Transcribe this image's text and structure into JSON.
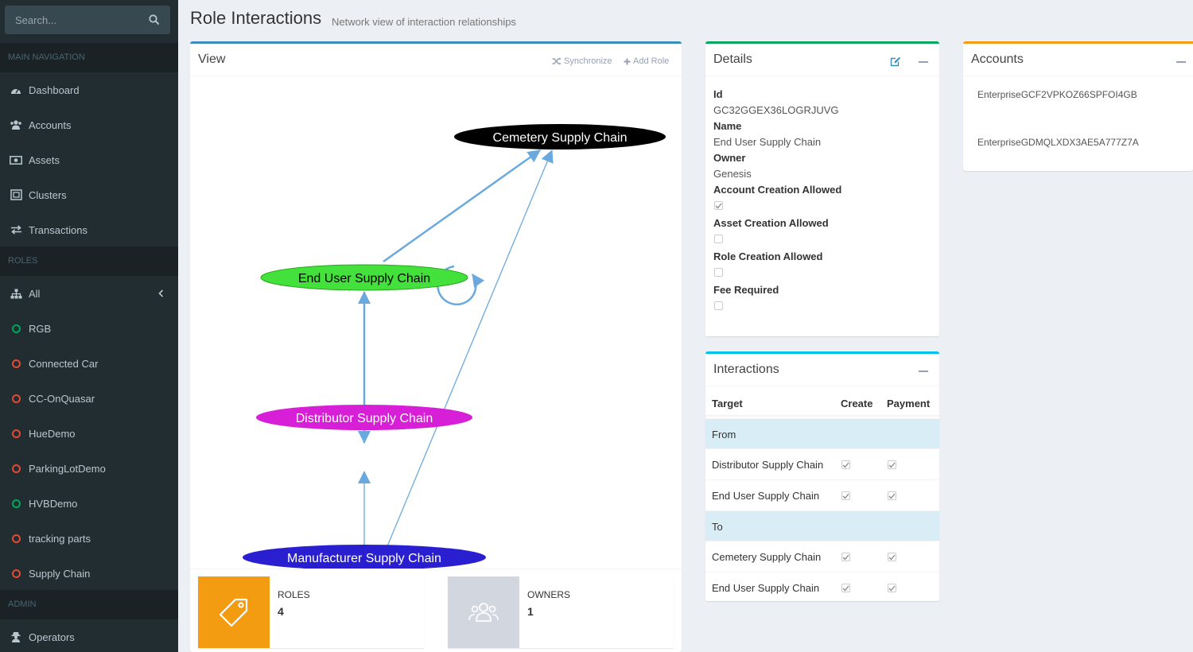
{
  "search": {
    "placeholder": "Search..."
  },
  "nav": {
    "main_header": "MAIN NAVIGATION",
    "main_items": [
      {
        "label": "Dashboard",
        "icon": "dashboard-icon"
      },
      {
        "label": "Accounts",
        "icon": "users-icon"
      },
      {
        "label": "Assets",
        "icon": "money-icon"
      },
      {
        "label": "Clusters",
        "icon": "clusters-icon"
      },
      {
        "label": "Transactions",
        "icon": "exchange-icon"
      }
    ],
    "roles_header": "ROLES",
    "role_items": [
      {
        "label": "All",
        "icon": "sitemap-icon"
      },
      {
        "label": "RGB",
        "status": "green"
      },
      {
        "label": "Connected Car",
        "status": "red"
      },
      {
        "label": "CC-OnQuasar",
        "status": "red"
      },
      {
        "label": "HueDemo",
        "status": "red"
      },
      {
        "label": "ParkingLotDemo",
        "status": "red"
      },
      {
        "label": "HVBDemo",
        "status": "green"
      },
      {
        "label": "tracking parts",
        "status": "red"
      },
      {
        "label": "Supply Chain",
        "status": "red"
      }
    ],
    "admin_header": "ADMIN",
    "admin_items": [
      {
        "label": "Operators",
        "icon": "user-secret-icon"
      }
    ]
  },
  "header": {
    "title": "Role Interactions",
    "subtitle": "Network view of interaction relationships"
  },
  "view": {
    "title": "View",
    "synchronize": "Synchronize",
    "add_role": "Add Role",
    "graph": {
      "nodes": [
        {
          "label": "Cemetery Supply Chain",
          "color": "#000000",
          "text": "#ffffff"
        },
        {
          "label": "End User Supply Chain",
          "color": "#44e03c",
          "text": "#000000"
        },
        {
          "label": "Distributor Supply Chain",
          "color": "#d61fd6",
          "text": "#ffffff"
        },
        {
          "label": "Manufacturer Supply Chain",
          "color": "#2a1fd0",
          "text": "#ffffff"
        }
      ],
      "edge_color": "#6aa9dd"
    }
  },
  "stats": {
    "roles_label": "ROLES",
    "roles_value": "4",
    "owners_label": "OWNERS",
    "owners_value": "1"
  },
  "details": {
    "title": "Details",
    "id_label": "Id",
    "id_value": "GC32GGEX36LOGRJUVG",
    "name_label": "Name",
    "name_value": "End User Supply Chain",
    "owner_label": "Owner",
    "owner_value": "Genesis",
    "account_creation_label": "Account Creation Allowed",
    "account_creation": true,
    "asset_creation_label": "Asset Creation Allowed",
    "asset_creation": false,
    "role_creation_label": "Role Creation Allowed",
    "role_creation": false,
    "fee_label": "Fee Required",
    "fee": false
  },
  "interactions": {
    "title": "Interactions",
    "columns": [
      "Target",
      "Create",
      "Payment"
    ],
    "from_label": "From",
    "from_rows": [
      {
        "target": "Distributor Supply Chain",
        "create": true,
        "payment": true
      },
      {
        "target": "End User Supply Chain",
        "create": true,
        "payment": true
      }
    ],
    "to_label": "To",
    "to_rows": [
      {
        "target": "Cemetery Supply Chain",
        "create": true,
        "payment": true
      },
      {
        "target": "End User Supply Chain",
        "create": true,
        "payment": true
      }
    ]
  },
  "accounts": {
    "title": "Accounts",
    "items": [
      "EnterpriseGCF2VPKOZ66SPFOI4GB",
      "EnterpriseGDMQLXDX3AE5A777Z7A"
    ]
  },
  "colors": {
    "sidebar": "#222d32",
    "primary": "#3c8dbc",
    "success": "#00a65a",
    "warning": "#f39c12",
    "info": "#00c0ef",
    "ok_ring": "#00a65a",
    "bad_ring": "#dd4b39"
  }
}
